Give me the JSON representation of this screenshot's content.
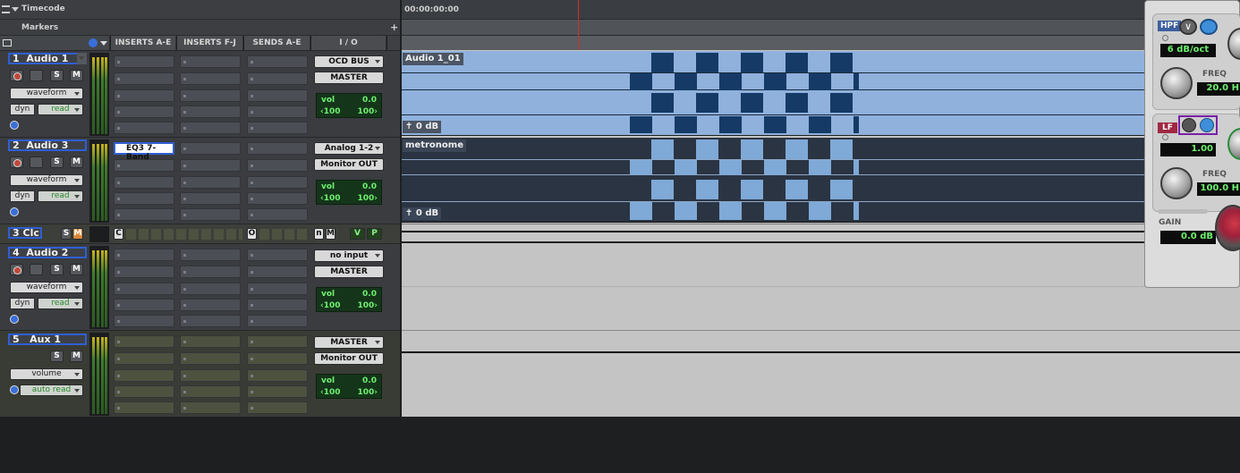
{
  "rulers": {
    "timecode_label": "Timecode",
    "timecode_value": "00:00:00:00",
    "markers_label": "Markers",
    "add_marker": "+"
  },
  "columns": {
    "inserts_ae": "INSERTS A-E",
    "inserts_fj": "INSERTS F-J",
    "sends_ae": "SENDS A-E",
    "io": "I / O"
  },
  "tracks": [
    {
      "num": "1",
      "name": "Audio 1",
      "view": "waveform",
      "dyn": "dyn",
      "auto": "read",
      "input": "OCD BUS",
      "output": "MASTER",
      "vol_label": "vol",
      "vol": "0.0",
      "pan_l": "‹100",
      "pan_r": "100›",
      "clip": "Audio 1_01",
      "clip_gain": "0 dB"
    },
    {
      "num": "2",
      "name": "Audio 3",
      "view": "waveform",
      "dyn": "dyn",
      "auto": "read",
      "input": "Analog 1-2",
      "output": "Monitor OUT",
      "vol_label": "vol",
      "vol": "0.0",
      "pan_l": "‹100",
      "pan_r": "100›",
      "insert": "EQ3 7-Band",
      "clip": "metronome",
      "clip_gain": "0 dB"
    },
    {
      "num": "3",
      "name": "Clc",
      "solo": "S",
      "mute": "M",
      "ins_c": "C",
      "send_o": "O",
      "n": "n",
      "m": "M",
      "v": "V",
      "p": "P"
    },
    {
      "num": "4",
      "name": "Audio 2",
      "view": "waveform",
      "dyn": "dyn",
      "auto": "read",
      "input": "no input",
      "output": "MASTER",
      "vol_label": "vol",
      "vol": "0.0",
      "pan_l": "‹100",
      "pan_r": "100›"
    },
    {
      "num": "5",
      "name": "Aux 1",
      "view": "volume",
      "auto": "auto read",
      "input": "MASTER",
      "output": "Monitor OUT",
      "vol_label": "vol",
      "vol": "0.0",
      "pan_l": "‹100",
      "pan_r": "100›"
    }
  ],
  "buttons": {
    "solo": "S",
    "mute": "M"
  },
  "plugin": {
    "hpf_label": "HPF",
    "hpf_slope": "6 dB/oct",
    "freq_label": "FREQ",
    "hpf_freq": "20.0 H",
    "lf_label": "LF",
    "lf_q": "1.00",
    "lf_freq": "100.0 H",
    "gain_label": "GAIN",
    "lf_gain": "0.0 dB"
  },
  "colors": {
    "selected": "#2f5fd4",
    "clip_audio": "#8fb1dc",
    "clip_dark": "#2b3442",
    "wave_dark": "#163a66",
    "wave_light": "#7fa9d6"
  }
}
